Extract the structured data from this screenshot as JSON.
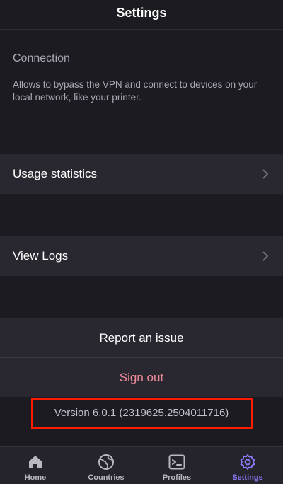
{
  "header": {
    "title": "Settings"
  },
  "connection": {
    "title": "Connection",
    "description": "Allows to bypass the VPN and connect to devices on your local network, like your printer."
  },
  "rows": {
    "usage_statistics": "Usage statistics",
    "view_logs": "View Logs"
  },
  "actions": {
    "report_issue": "Report an issue",
    "sign_out": "Sign out"
  },
  "version": "Version 6.0.1 (2319625.2504011716)",
  "tabs": [
    {
      "label": "Home",
      "icon": "home-icon"
    },
    {
      "label": "Countries",
      "icon": "globe-icon"
    },
    {
      "label": "Profiles",
      "icon": "terminal-icon"
    },
    {
      "label": "Settings",
      "icon": "gear-icon",
      "active": true
    }
  ],
  "colors": {
    "background": "#1c1b22",
    "row": "#292830",
    "accent": "#8c7dff",
    "sign_out": "#f08a9a",
    "highlight_box": "#ff1a00"
  }
}
